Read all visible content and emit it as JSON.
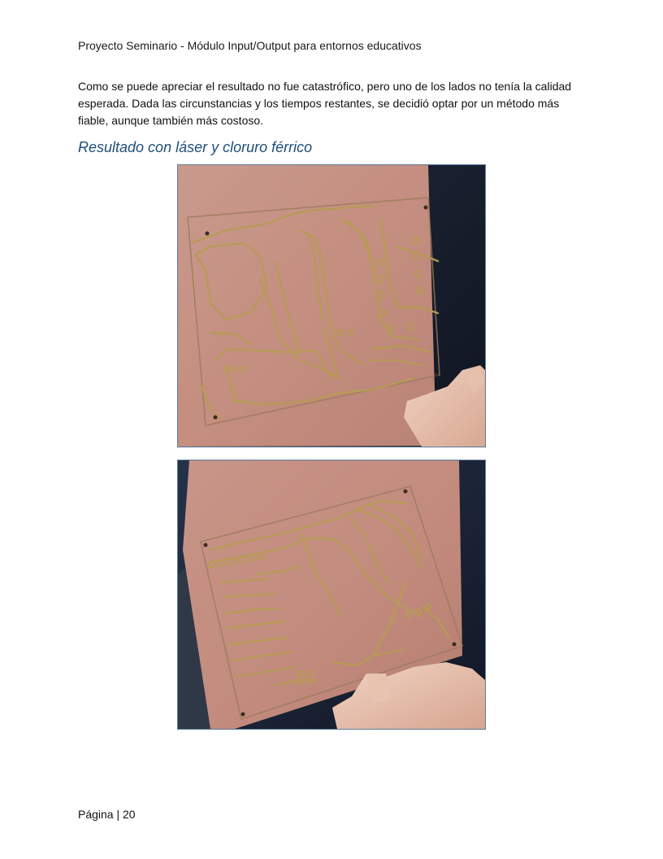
{
  "header": {
    "title": "Proyecto Seminario - Módulo Input/Output para entornos educativos"
  },
  "body": {
    "paragraph": "Como se puede apreciar el resultado no fue catastrófico, pero uno de los lados no tenía la calidad esperada. Dada las circunstancias y los tiempos restantes, se decidió optar por un método más fiable, aunque también más costoso."
  },
  "section": {
    "heading": "Resultado con láser y cloruro férrico"
  },
  "figures": [
    {
      "icon": "pcb-photo-front"
    },
    {
      "icon": "pcb-photo-back"
    }
  ],
  "colors": {
    "heading": "#1f4e79",
    "copper_board": "#c9968a",
    "trace": "#b79b55",
    "background_dark": "#1c2230"
  },
  "footer": {
    "page_label": "Página | 20"
  }
}
